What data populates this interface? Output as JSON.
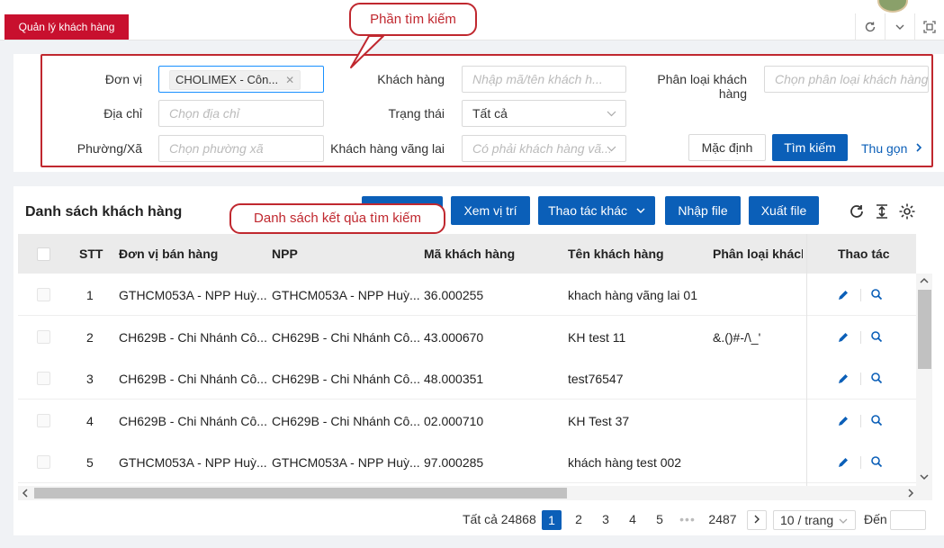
{
  "topbar": {
    "ghost_left": "...",
    "ghost_right": "..."
  },
  "tabs": {
    "active_label": "Quản lý khách hàng"
  },
  "callouts": {
    "search_area": "Phần tìm kiếm",
    "result_list": "Danh sách kết qủa tìm kiếm"
  },
  "search": {
    "unit_label": "Đơn vị",
    "unit_tag": "CHOLIMEX - Côn...",
    "customer_label": "Khách hàng",
    "customer_placeholder": "Nhập mã/tên khách h...",
    "category_label": "Phân loại khách hàng",
    "category_placeholder": "Chọn phân loại khách hàng",
    "address_label": "Địa chỉ",
    "address_placeholder": "Chọn địa chỉ",
    "status_label": "Trạng thái",
    "status_value": "Tất cả",
    "ward_label": "Phường/Xã",
    "ward_placeholder": "Chọn phường xã",
    "walkin_label": "Khách hàng vãng lai",
    "walkin_placeholder": "Có phải khách hàng vã...",
    "reset_label": "Mặc định",
    "search_label": "Tìm kiếm",
    "collapse_label": "Thu gọn"
  },
  "list": {
    "title": "Danh sách khách hàng",
    "buttons": {
      "hidden_first": "",
      "view_location": "Xem vị trí",
      "more_actions": "Thao tác khác",
      "import": "Nhập file",
      "export": "Xuất file"
    },
    "columns": {
      "stt": "STT",
      "unit": "Đơn vị bán hàng",
      "npp": "NPP",
      "code": "Mã khách hàng",
      "name": "Tên khách hàng",
      "category": "Phân loại khách",
      "actions": "Thao tác"
    },
    "rows": [
      {
        "stt": "1",
        "unit": "GTHCM053A - NPP Huỳ...",
        "npp": "GTHCM053A - NPP Huỳ...",
        "code": "36.000255",
        "name": "khach hàng vãng lai 01",
        "category": ""
      },
      {
        "stt": "2",
        "unit": "CH629B - Chi Nhánh Cô...",
        "npp": "CH629B - Chi Nhánh Cô...",
        "code": "43.000670",
        "name": "KH test 11",
        "category": "&.()#-/\\_'"
      },
      {
        "stt": "3",
        "unit": "CH629B - Chi Nhánh Cô...",
        "npp": "CH629B - Chi Nhánh Cô...",
        "code": "48.000351",
        "name": "test76547",
        "category": ""
      },
      {
        "stt": "4",
        "unit": "CH629B - Chi Nhánh Cô...",
        "npp": "CH629B - Chi Nhánh Cô...",
        "code": "02.000710",
        "name": "KH Test 37",
        "category": ""
      },
      {
        "stt": "5",
        "unit": "GTHCM053A - NPP Huỳ...",
        "npp": "GTHCM053A - NPP Huỳ...",
        "code": "97.000285",
        "name": "khách hàng test 002",
        "category": ""
      }
    ]
  },
  "pagination": {
    "total": "Tất cả 24868",
    "pages": [
      "1",
      "2",
      "3",
      "4",
      "5"
    ],
    "ellipsis": "•••",
    "last": "2487",
    "page_size": "10 / trang",
    "goto_label": "Đến"
  },
  "colors": {
    "brand_red": "#c8102e",
    "primary": "#0b5fb8",
    "callout": "#c0282f"
  }
}
